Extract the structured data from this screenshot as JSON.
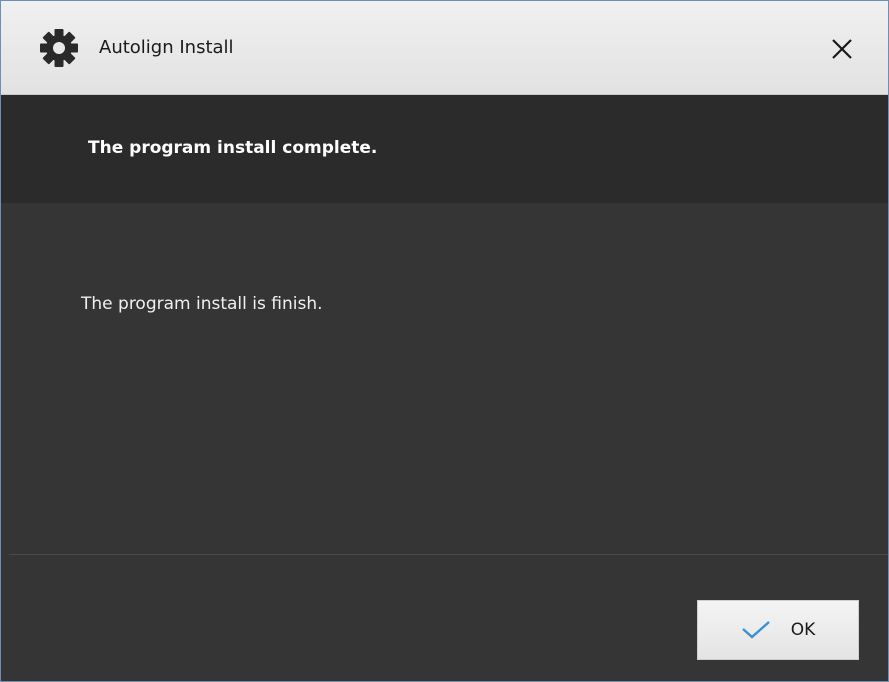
{
  "window": {
    "title": "Autolign Install",
    "app_icon": "gear-icon",
    "close_icon": "close-icon"
  },
  "header": {
    "title": "The program install complete."
  },
  "content": {
    "message": "The program install is finish."
  },
  "footer": {
    "ok_label": "OK",
    "ok_icon": "checkmark-icon"
  },
  "colors": {
    "titlebar": "#e8e8e8",
    "header_band": "#2b2b2b",
    "body": "#353535",
    "accent_check": "#3b8fd6"
  }
}
